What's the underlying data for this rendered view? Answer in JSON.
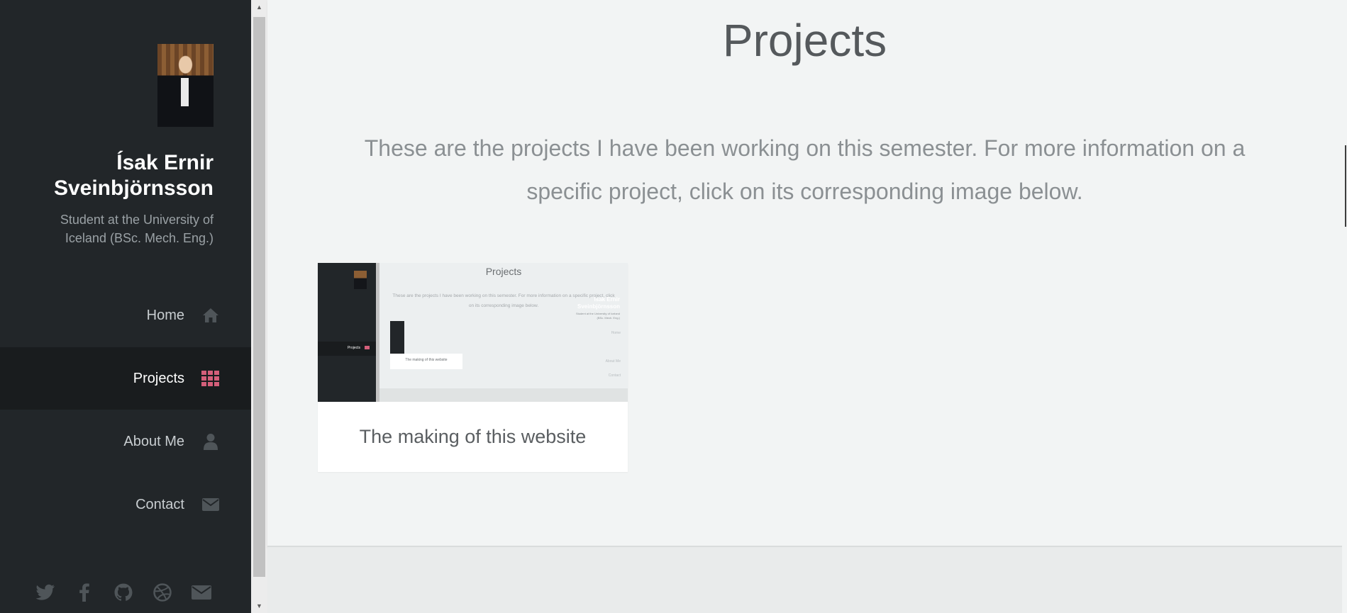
{
  "sidebar": {
    "author_name": "Ísak Ernir Sveinbjörnsson",
    "author_subtitle": "Student at the University of Iceland (BSc. Mech. Eng.)",
    "nav": [
      {
        "label": "Home",
        "icon": "home-icon"
      },
      {
        "label": "Projects",
        "icon": "grid-icon",
        "active": true
      },
      {
        "label": "About Me",
        "icon": "user-icon"
      },
      {
        "label": "Contact",
        "icon": "envelope-icon"
      }
    ],
    "social": [
      "twitter-icon",
      "facebook-icon",
      "github-icon",
      "dribbble-icon",
      "envelope-icon"
    ]
  },
  "main": {
    "title": "Projects",
    "intro": "These are the projects I have been working on this semester. For more information on a specific project, click on its corresponding image below.",
    "projects": [
      {
        "title": "The making of this website"
      }
    ]
  },
  "thumbnail": {
    "title": "Projects",
    "name": "Ísak Ernir Sveinbjörnsson",
    "subtitle": "Student at the University of Iceland (BSc. Mech. Eng.)",
    "intro": "These are the projects I have been working on this semester. For more information on a specific project, click on its corresponding image below.",
    "nav": [
      "Home",
      "Projects",
      "About Me",
      "Contact"
    ],
    "card_title": "The making of this website"
  },
  "colors": {
    "sidebar_bg": "#222629",
    "active_nav_bg": "#191c1e",
    "accent": "#d45f7a",
    "main_bg": "#f2f4f4"
  }
}
